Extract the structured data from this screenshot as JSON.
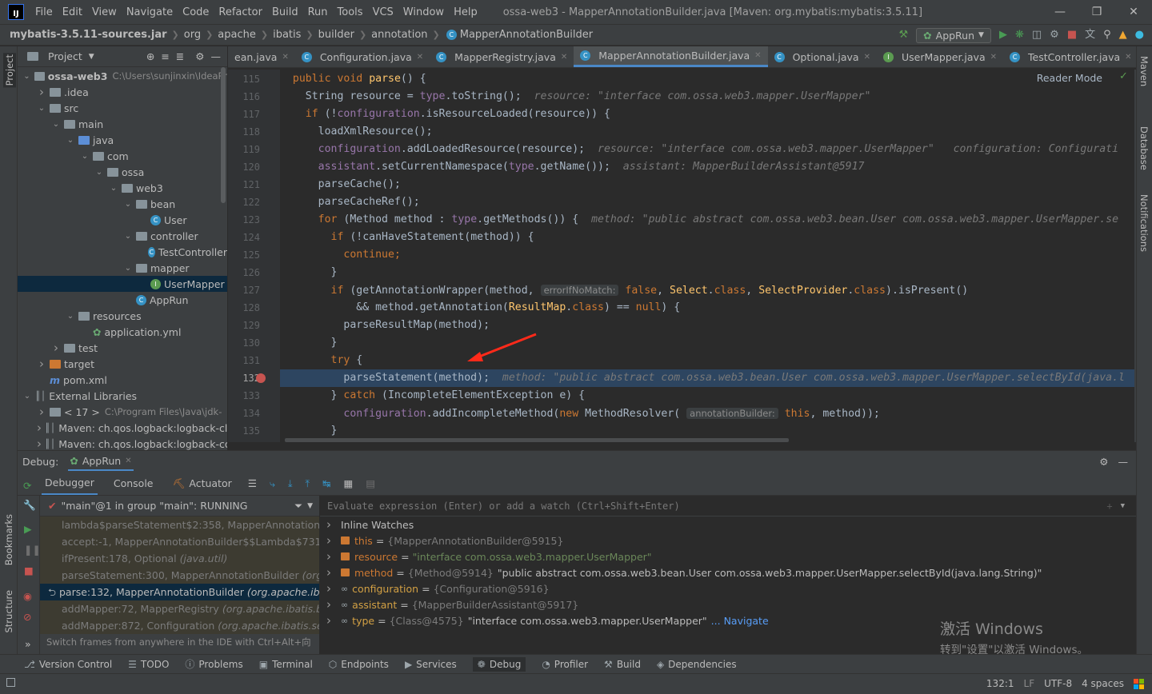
{
  "menubar": {
    "logo": "IJ",
    "items": [
      "File",
      "Edit",
      "View",
      "Navigate",
      "Code",
      "Refactor",
      "Build",
      "Run",
      "Tools",
      "VCS",
      "Window",
      "Help"
    ],
    "title": "ossa-web3 - MapperAnnotationBuilder.java [Maven: org.mybatis:mybatis:3.5.11]"
  },
  "breadcrumbs": [
    "mybatis-3.5.11-sources.jar",
    "org",
    "apache",
    "ibatis",
    "builder",
    "annotation",
    "MapperAnnotationBuilder"
  ],
  "run_config": "AppRun",
  "side_left": {
    "project": "Project",
    "bookmarks": "Bookmarks",
    "structure": "Structure"
  },
  "side_right": {
    "maven": "Maven",
    "database": "Database",
    "notifications": "Notifications"
  },
  "project_panel": {
    "title": "Project",
    "tree": [
      {
        "label": "ossa-web3",
        "extra": "C:\\Users\\sunjinxin\\IdeaPr",
        "depth": 0,
        "icon": "folder",
        "arrow": "down",
        "bold": true
      },
      {
        "label": ".idea",
        "depth": 1,
        "icon": "folder",
        "arrow": "right"
      },
      {
        "label": "src",
        "depth": 1,
        "icon": "folder",
        "arrow": "down"
      },
      {
        "label": "main",
        "depth": 2,
        "icon": "folder",
        "arrow": "down"
      },
      {
        "label": "java",
        "depth": 3,
        "icon": "folder-blue",
        "arrow": "down"
      },
      {
        "label": "com",
        "depth": 4,
        "icon": "folder",
        "arrow": "down"
      },
      {
        "label": "ossa",
        "depth": 5,
        "icon": "folder",
        "arrow": "down"
      },
      {
        "label": "web3",
        "depth": 6,
        "icon": "folder",
        "arrow": "down"
      },
      {
        "label": "bean",
        "depth": 7,
        "icon": "folder",
        "arrow": "down"
      },
      {
        "label": "User",
        "depth": 8,
        "icon": "class"
      },
      {
        "label": "controller",
        "depth": 7,
        "icon": "folder",
        "arrow": "down"
      },
      {
        "label": "TestController",
        "depth": 8,
        "icon": "class"
      },
      {
        "label": "mapper",
        "depth": 7,
        "icon": "folder",
        "arrow": "down"
      },
      {
        "label": "UserMapper",
        "depth": 8,
        "icon": "interface",
        "selected": true
      },
      {
        "label": "AppRun",
        "depth": 7,
        "icon": "class"
      },
      {
        "label": "resources",
        "depth": 3,
        "icon": "folder",
        "arrow": "down"
      },
      {
        "label": "application.yml",
        "depth": 4,
        "icon": "yml"
      },
      {
        "label": "test",
        "depth": 2,
        "icon": "folder",
        "arrow": "right"
      },
      {
        "label": "target",
        "depth": 1,
        "icon": "folder-orange",
        "arrow": "right"
      },
      {
        "label": "pom.xml",
        "depth": 1,
        "icon": "maven"
      },
      {
        "label": "External Libraries",
        "depth": 0,
        "icon": "libs",
        "arrow": "down"
      },
      {
        "label": "< 17 >",
        "extra": "C:\\Program Files\\Java\\jdk-",
        "depth": 1,
        "icon": "folder",
        "arrow": "right"
      },
      {
        "label": "Maven: ch.qos.logback:logback-cl",
        "depth": 1,
        "icon": "libs",
        "arrow": "right"
      },
      {
        "label": "Maven: ch.qos.logback:logback-co",
        "depth": 1,
        "icon": "libs",
        "arrow": "right"
      }
    ]
  },
  "editor_tabs": [
    {
      "label": "ean.java"
    },
    {
      "label": "Configuration.java"
    },
    {
      "label": "MapperRegistry.java"
    },
    {
      "label": "MapperAnnotationBuilder.java",
      "active": true
    },
    {
      "label": "Optional.java"
    },
    {
      "label": "UserMapper.java"
    },
    {
      "label": "TestController.java"
    }
  ],
  "reader_mode": "Reader Mode",
  "editor": {
    "line_numbers": [
      "115",
      "116",
      "117",
      "118",
      "119",
      "120",
      "121",
      "122",
      "123",
      "124",
      "125",
      "126",
      "127",
      "128",
      "129",
      "130",
      "131",
      "132",
      "133",
      "134",
      "135"
    ],
    "breakpoint_line": "132"
  },
  "debug": {
    "label": "Debug:",
    "config": "AppRun",
    "tabs": [
      "Debugger",
      "Console",
      "Actuator"
    ],
    "thread": "\"main\"@1 in group \"main\": RUNNING",
    "frames": [
      {
        "name": "lambda$parseStatement$2:358, MapperAnnotationBuild",
        "pkg": ""
      },
      {
        "name": "accept:-1, MapperAnnotationBuilder$$Lambda$731/0x0",
        "pkg": ""
      },
      {
        "name": "ifPresent:178, Optional",
        "pkg": "(java.util)"
      },
      {
        "name": "parseStatement:300, MapperAnnotationBuilder",
        "pkg": "(org.apa"
      },
      {
        "name": "parse:132, MapperAnnotationBuilder",
        "pkg": "(org.apache.ibatis",
        "selected": true
      },
      {
        "name": "addMapper:72, MapperRegistry",
        "pkg": "(org.apache.ibatis.binc"
      },
      {
        "name": "addMapper:872, Configuration",
        "pkg": "(org.apache.ibatis.sessi"
      }
    ],
    "frames_hint": "Switch frames from anywhere in the IDE with Ctrl+Alt+向上...",
    "eval_placeholder": "Evaluate expression (Enter) or add a watch (Ctrl+Shift+Enter)",
    "variables": [
      {
        "kind": "group",
        "name": "Inline Watches"
      },
      {
        "kind": "field",
        "name": "this",
        "ref": "{MapperAnnotationBuilder@5915}",
        "value": ""
      },
      {
        "kind": "field",
        "name": "resource",
        "ref": "",
        "value": "\"interface com.ossa.web3.mapper.UserMapper\"",
        "is_string": true
      },
      {
        "kind": "field",
        "name": "method",
        "ref": "{Method@5914}",
        "value": "\"public abstract com.ossa.web3.bean.User com.ossa.web3.mapper.UserMapper.selectById(java.lang.String)\""
      },
      {
        "kind": "object",
        "name": "configuration",
        "ref": "{Configuration@5916}",
        "value": ""
      },
      {
        "kind": "object",
        "name": "assistant",
        "ref": "{MapperBuilderAssistant@5917}",
        "value": ""
      },
      {
        "kind": "object",
        "name": "type",
        "ref": "{Class@4575}",
        "value": "\"interface com.ossa.web3.mapper.UserMapper\"",
        "link": "... Navigate"
      }
    ]
  },
  "watermark": {
    "line1": "激活 Windows",
    "line2": "转到\"设置\"以激活 Windows。"
  },
  "bottom_tools": [
    "Version Control",
    "TODO",
    "Problems",
    "Terminal",
    "Endpoints",
    "Services",
    "Debug",
    "Profiler",
    "Build",
    "Dependencies"
  ],
  "active_bottom_tool": "Debug",
  "status": {
    "position": "132:1",
    "line_sep": "LF",
    "encoding": "UTF-8",
    "indent": "4 spaces"
  },
  "colors": {
    "accent": "#4a88c7",
    "keyword": "#cc7832",
    "breakpoint": "#c75450",
    "string": "#6a8759"
  }
}
